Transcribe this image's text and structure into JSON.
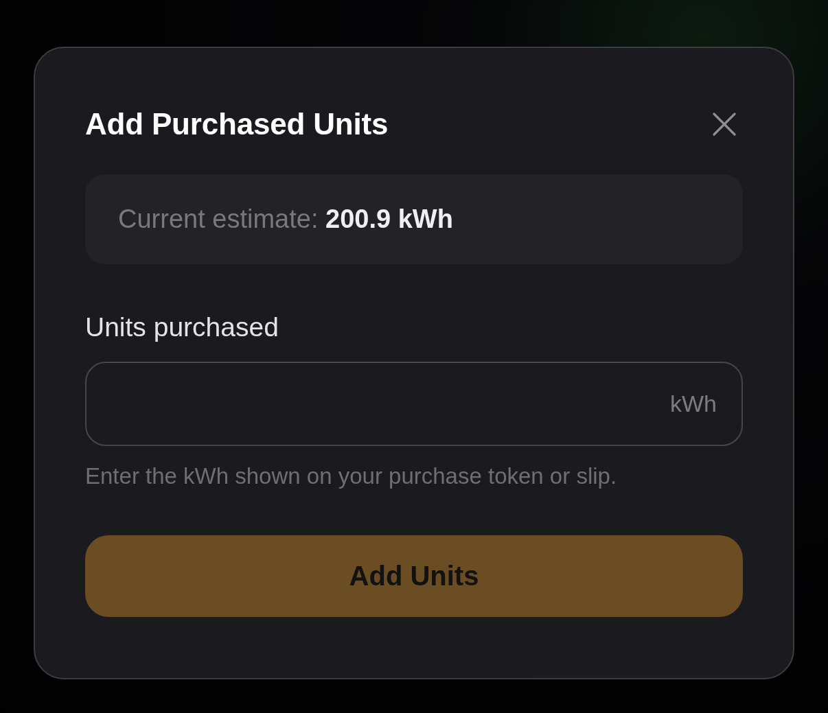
{
  "dialog": {
    "title": "Add Purchased Units",
    "estimate": "Current estimate: **200.9 kWh**",
    "field": {
      "label": "Units purchased",
      "unit": "kWh"
    },
    "hint": "Enter the kWh shown on your purchase token or slip.",
    "button": "Add Units"
  }
}
